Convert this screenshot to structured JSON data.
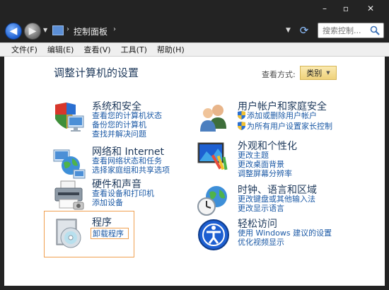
{
  "address": {
    "path": "控制面板"
  },
  "search": {
    "placeholder": "搜索控制..."
  },
  "menu": [
    "文件(F)",
    "编辑(E)",
    "查看(V)",
    "工具(T)",
    "帮助(H)"
  ],
  "page": {
    "title": "调整计算机的设置",
    "view_by_label": "查看方式:",
    "view_by_value": "类别"
  },
  "categories": [
    {
      "title": "系统和安全",
      "links": [
        "查看您的计算机状态",
        "备份您的计算机",
        "查找并解决问题"
      ]
    },
    {
      "title": "网络和 Internet",
      "links": [
        "查看网络状态和任务",
        "选择家庭组和共享选项"
      ]
    },
    {
      "title": "硬件和声音",
      "links": [
        "查看设备和打印机",
        "添加设备"
      ]
    },
    {
      "title": "程序",
      "links": [
        "卸载程序"
      ]
    },
    {
      "title": "用户帐户和家庭安全",
      "links": [
        "添加或删除用户帐户",
        "为所有用户设置家长控制"
      ]
    },
    {
      "title": "外观和个性化",
      "links": [
        "更改主题",
        "更改桌面背景",
        "调整屏幕分辨率"
      ]
    },
    {
      "title": "时钟、语言和区域",
      "links": [
        "更改键盘或其他输入法",
        "更改显示语言"
      ]
    },
    {
      "title": "轻松访问",
      "links": [
        "使用 Windows 建议的设置",
        "优化视频显示"
      ]
    }
  ]
}
